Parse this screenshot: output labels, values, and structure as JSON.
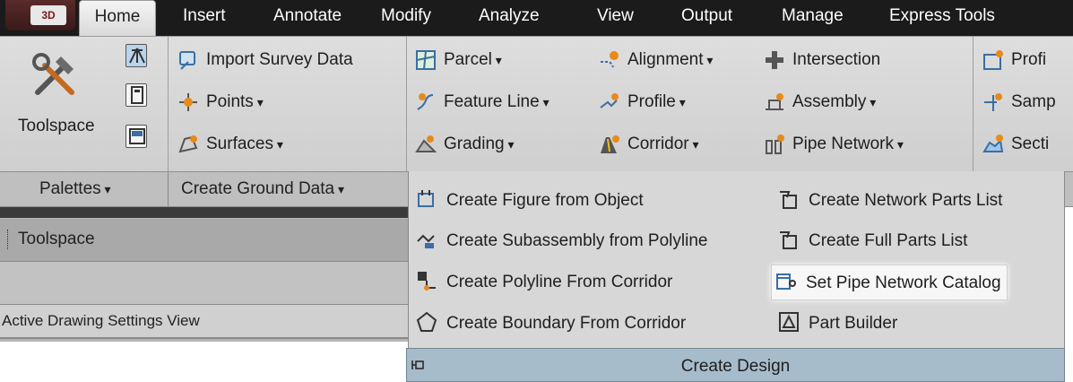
{
  "app_badge": "3D",
  "tabs": [
    "Home",
    "Insert",
    "Annotate",
    "Modify",
    "Analyze",
    "View",
    "Output",
    "Manage",
    "Express Tools"
  ],
  "active_tab": "Home",
  "ribbon": {
    "toolspace": {
      "label": "Toolspace"
    },
    "ground_data": {
      "import_survey": "Import Survey Data",
      "points": "Points",
      "surfaces": "Surfaces"
    },
    "create_design": {
      "parcel": "Parcel",
      "feature_line": "Feature Line",
      "grading": "Grading",
      "alignment": "Alignment",
      "profile": "Profile",
      "corridor": "Corridor",
      "intersection": "Intersection",
      "assembly": "Assembly",
      "pipe_network": "Pipe Network",
      "profile_view_clipped": "Profi",
      "sample_lines_clipped": "Samp",
      "sections_clipped": "Secti"
    },
    "panel_titles": {
      "palettes": "Palettes",
      "create_ground_data": "Create Ground Data"
    }
  },
  "palette_area": {
    "toolspace_title": "Toolspace",
    "active_drawing_settings": "Active Drawing Settings View"
  },
  "dropdown": {
    "items_left": [
      "Create Figure from Object",
      "Create Subassembly from Polyline",
      "Create Polyline From Corridor",
      "Create Boundary From Corridor"
    ],
    "items_right": [
      "Create Network Parts List",
      "Create Full Parts List",
      "Set Pipe Network Catalog",
      "Part Builder"
    ],
    "highlighted": "Set Pipe Network Catalog",
    "panel_title": "Create Design"
  },
  "colors": {
    "tabbar": "#1b1b1b",
    "ribbon": "#d6d6d6",
    "panel_bar": "#a7bccb",
    "icon_orange": "#e88a1a",
    "icon_blue": "#3a6ea5"
  }
}
